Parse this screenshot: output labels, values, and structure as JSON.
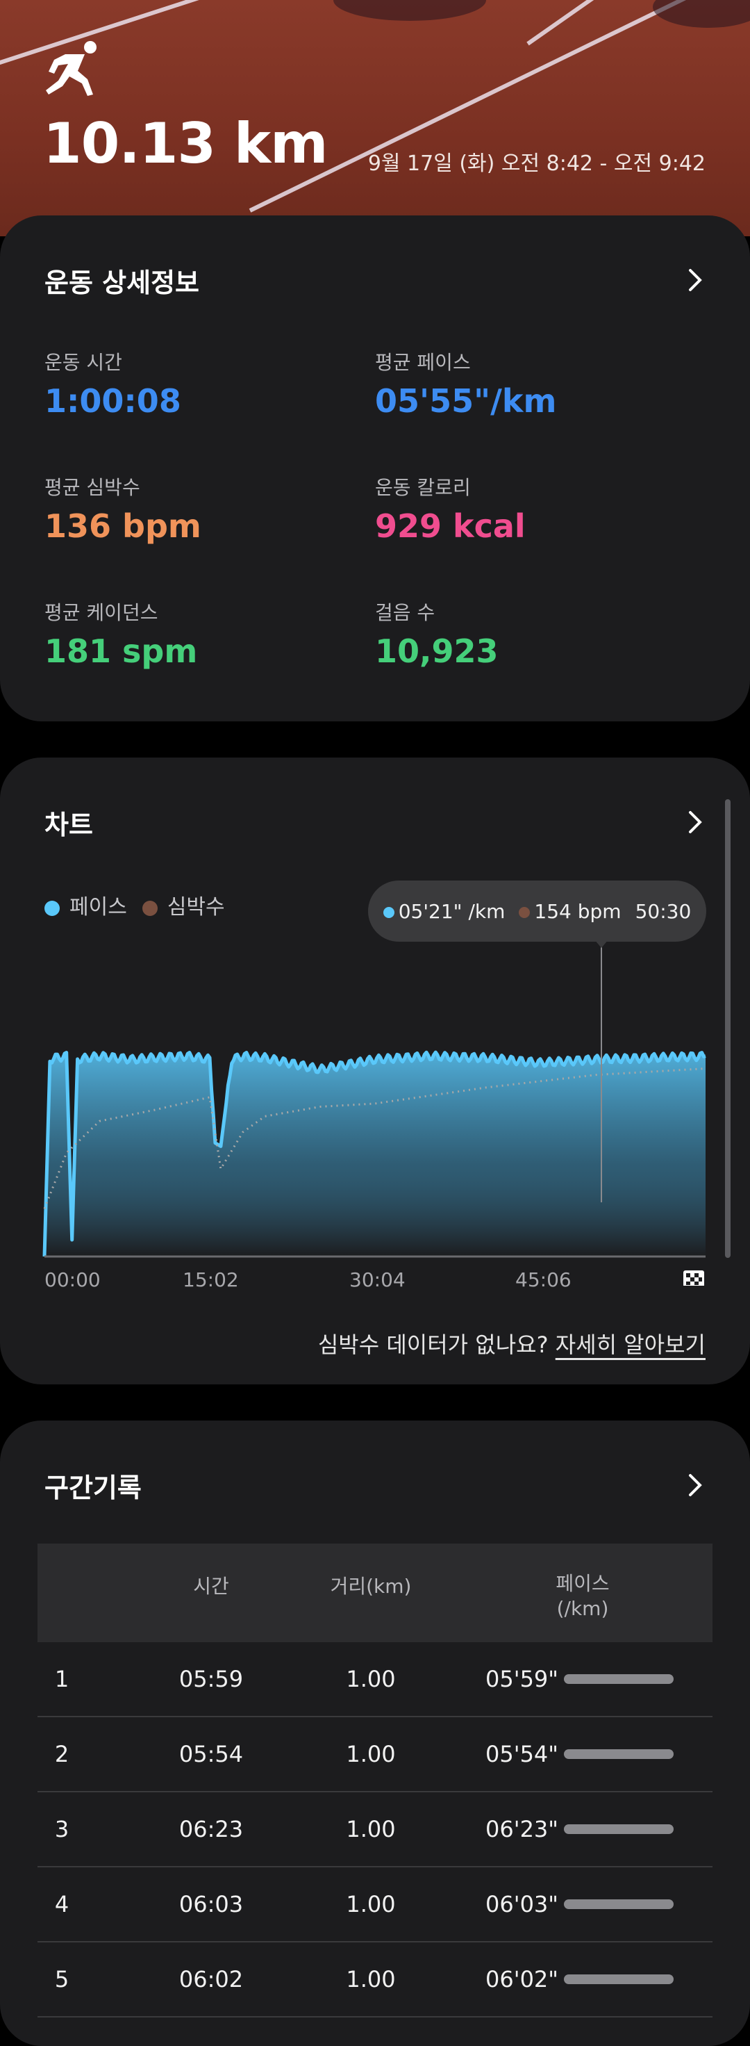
{
  "hero": {
    "distance": "10.13 km",
    "time_range": "9월 17일 (화) 오전 8:42 - 오전 9:42"
  },
  "details": {
    "title": "운동 상세정보",
    "stats": [
      {
        "label": "운동 시간",
        "value": "1:00:08"
      },
      {
        "label": "평균 페이스",
        "value": "05'55\"/km"
      },
      {
        "label": "평균 심박수",
        "value": "136 bpm"
      },
      {
        "label": "운동 칼로리",
        "value": "929 kcal"
      },
      {
        "label": "평균 케이던스",
        "value": "181 spm"
      },
      {
        "label": "걸음 수",
        "value": "10,923"
      }
    ]
  },
  "chart": {
    "title": "차트",
    "legend_pace": "페이스",
    "legend_hr": "심박수",
    "tooltip": {
      "pace": "05'21\" /km",
      "hr": "154 bpm",
      "time": "50:30"
    },
    "x_ticks": [
      "00:00",
      "15:02",
      "30:04",
      "45:06"
    ],
    "hr_note": "심박수 데이터가 없나요?",
    "hr_link": "자세히 알아보기",
    "colors": {
      "pace": "#5ac8fa",
      "hr": "#7a5040"
    }
  },
  "chart_data": {
    "type": "area",
    "series": [
      {
        "name": "페이스",
        "x": [
          0,
          0.5,
          1,
          2,
          2.5,
          3,
          4,
          5,
          8,
          10,
          13,
          15,
          15.5,
          16,
          17,
          18,
          20,
          25,
          30,
          35,
          40,
          45,
          50,
          55,
          60
        ],
        "values": [
          0,
          5.9,
          5.95,
          6.0,
          0.5,
          5.9,
          5.95,
          6.0,
          5.9,
          5.95,
          6.0,
          5.9,
          3.4,
          3.3,
          5.9,
          6.0,
          5.95,
          5.6,
          5.9,
          6.0,
          5.95,
          5.8,
          5.9,
          5.95,
          6.0
        ]
      },
      {
        "name": "심박수",
        "x": [
          0,
          2,
          5,
          10,
          15,
          16,
          18,
          20,
          25,
          30,
          35,
          40,
          45,
          50,
          55,
          60
        ],
        "values": [
          70,
          105,
          125,
          132,
          140,
          95,
          118,
          128,
          134,
          136,
          141,
          146,
          150,
          154,
          156,
          158
        ]
      }
    ],
    "x_ticks": [
      "00:00",
      "15:02",
      "30:04",
      "45:06"
    ]
  },
  "laps": {
    "title": "구간기록",
    "headers": {
      "time": "시간",
      "distance": "거리(km)",
      "pace": "페이스\n(/km)"
    },
    "rows": [
      {
        "no": "1",
        "time": "05:59",
        "distance": "1.00",
        "pace": "05'59\""
      },
      {
        "no": "2",
        "time": "05:54",
        "distance": "1.00",
        "pace": "05'54\""
      },
      {
        "no": "3",
        "time": "06:23",
        "distance": "1.00",
        "pace": "06'23\""
      },
      {
        "no": "4",
        "time": "06:03",
        "distance": "1.00",
        "pace": "06'03\""
      },
      {
        "no": "5",
        "time": "06:02",
        "distance": "1.00",
        "pace": "06'02\""
      }
    ]
  }
}
